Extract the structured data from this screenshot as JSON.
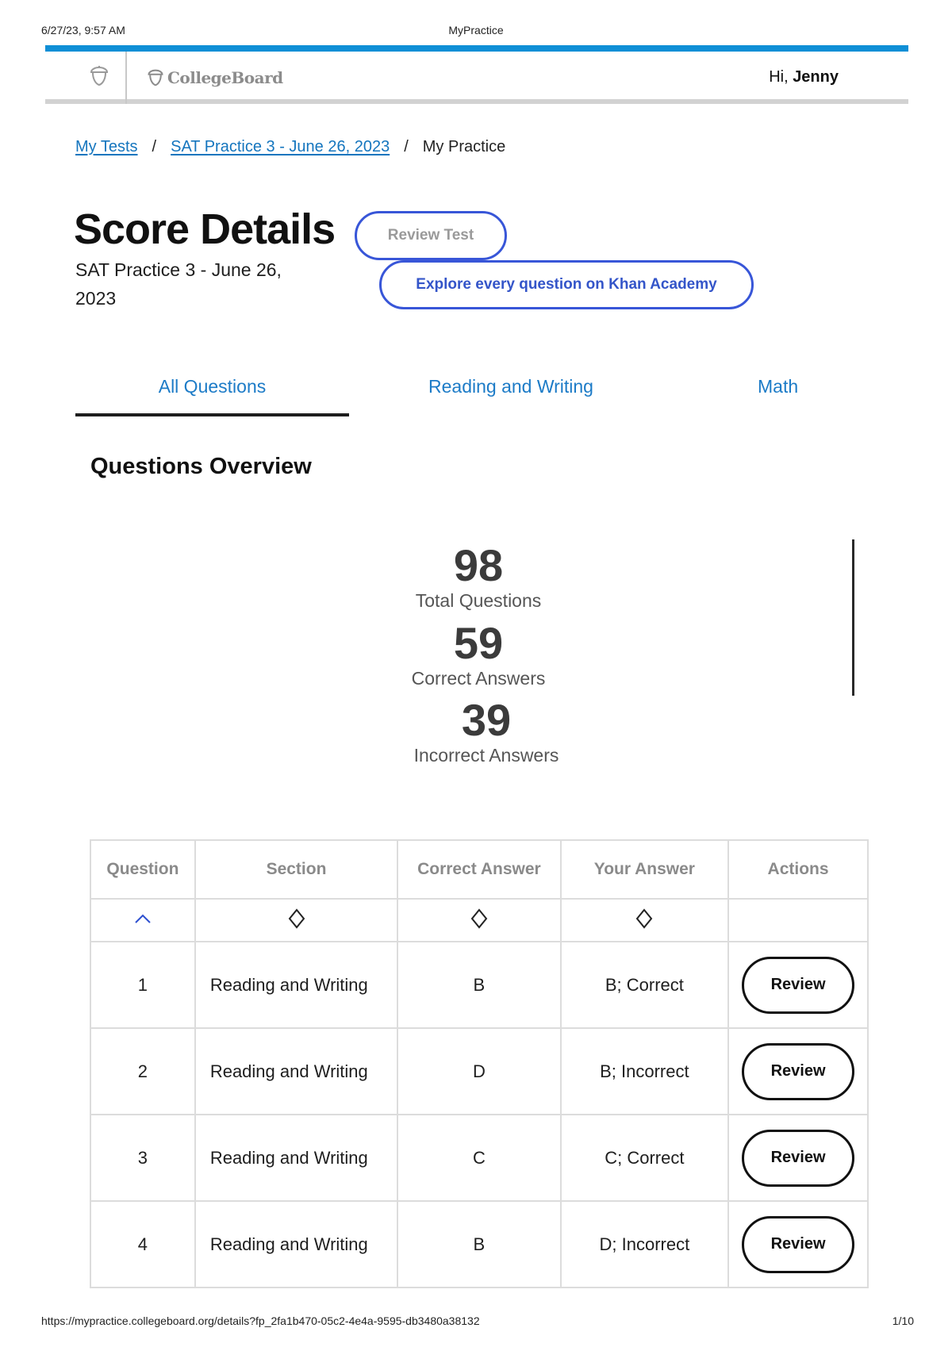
{
  "print_meta": {
    "date": "6/27/23, 9:57 AM",
    "title": "MyPractice",
    "url": "https://mypractice.collegeboard.org/details?fp_2fa1b470-05c2-4e4a-9595-db3480a38132",
    "page": "1/10"
  },
  "header": {
    "logo_text": "CollegeBoard",
    "greeting_prefix": "Hi, ",
    "user_name": "Jenny",
    "icons": [
      "acorn-icon",
      "acorn-logo-icon"
    ]
  },
  "breadcrumb": {
    "items": [
      "My Tests",
      "SAT Practice 3 - June 26, 2023"
    ],
    "separator": "/",
    "current": "My Practice"
  },
  "page": {
    "title": "Score Details",
    "subtitle": "SAT Practice 3 - June 26, 2023"
  },
  "buttons": {
    "review_test": "Review Test",
    "khan": "Explore every question on Khan Academy"
  },
  "tabs": [
    {
      "label": "All Questions",
      "selected": true
    },
    {
      "label": "Reading and Writing",
      "selected": false
    },
    {
      "label": "Math",
      "selected": false
    }
  ],
  "overview": {
    "heading": "Questions Overview",
    "stats": [
      {
        "value": "98",
        "label": "Total Questions"
      },
      {
        "value": "59",
        "label": "Correct Answers"
      },
      {
        "value": "39",
        "label": "Incorrect Answers"
      }
    ]
  },
  "table": {
    "headers": [
      "Question",
      "Section",
      "Correct Answer",
      "Your Answer",
      "Actions"
    ],
    "sort_icons": [
      "sort-ascending-icon",
      "sort-icon",
      "sort-icon",
      "sort-icon"
    ],
    "rows": [
      {
        "question": "1",
        "section": "Reading and Writing",
        "correct": "B",
        "your": "B; Correct",
        "status": "correct",
        "action": "Review"
      },
      {
        "question": "2",
        "section": "Reading and Writing",
        "correct": "D",
        "your": "B; Incorrect",
        "status": "incorrect",
        "action": "Review"
      },
      {
        "question": "3",
        "section": "Reading and Writing",
        "correct": "C",
        "your": "C; Correct",
        "status": "correct",
        "action": "Review"
      },
      {
        "question": "4",
        "section": "Reading and Writing",
        "correct": "B",
        "your": "D; Incorrect",
        "status": "incorrect",
        "action": "Review"
      }
    ]
  },
  "colors": {
    "accent_blue": "#0f8fd6",
    "link_blue": "#1475be",
    "button_blue": "#3856d8",
    "correct_green": "#2e7d32",
    "incorrect_red": "#b0182b"
  }
}
